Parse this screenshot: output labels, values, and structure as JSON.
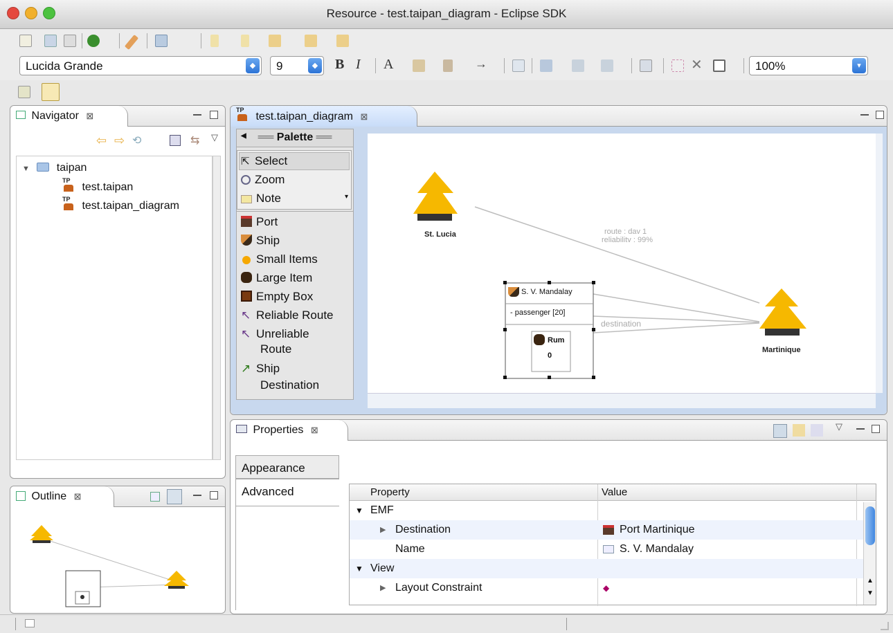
{
  "window": {
    "title": "Resource - test.taipan_diagram - Eclipse SDK",
    "traffic_colors": [
      "#e5483e",
      "#f1b02c",
      "#4cc23f"
    ]
  },
  "toolbar": {
    "font_name": "Lucida Grande",
    "font_size": "9",
    "bold_label": "B",
    "italic_label": "I",
    "font_color_label": "A",
    "zoom": "100%"
  },
  "navigator": {
    "tab_label": "Navigator",
    "close_glyph": "⊠",
    "tree": [
      {
        "label": "taipan",
        "type": "folder",
        "expanded": true
      },
      {
        "label": "test.taipan",
        "type": "file"
      },
      {
        "label": "test.taipan_diagram",
        "type": "file"
      }
    ]
  },
  "editor": {
    "tab_label": "test.taipan_diagram",
    "close_glyph": "⊠"
  },
  "palette": {
    "title": "Palette",
    "items": [
      {
        "label": "Select",
        "icon": "arrow-cursor-icon"
      },
      {
        "label": "Zoom",
        "icon": "zoom-icon"
      },
      {
        "label": "Note",
        "icon": "note-icon"
      },
      {
        "label": "Port",
        "icon": "port-icon"
      },
      {
        "label": "Ship",
        "icon": "ship-icon"
      },
      {
        "label": "Small Items",
        "icon": "small-items-icon"
      },
      {
        "label": "Large Item",
        "icon": "large-item-icon"
      },
      {
        "label": "Empty Box",
        "icon": "empty-box-icon"
      },
      {
        "label": "Reliable Route",
        "icon": "reliable-route-icon"
      },
      {
        "label": "Unreliable",
        "icon": "unreliable-route-icon"
      },
      {
        "label": "Route",
        "icon": ""
      },
      {
        "label": "Ship",
        "icon": "ship-destination-icon"
      },
      {
        "label": "Destination",
        "icon": ""
      }
    ]
  },
  "diagram": {
    "port1_label": "St. Lucia",
    "port2_label": "Martinique",
    "route_label_1": "route : dav 1",
    "route_label_2": "reliabilitv : 99%",
    "destination_label": "destination",
    "ship_name": "S. V. Mandalay",
    "ship_attr": "- passenger [20]",
    "cargo_name": "Rum",
    "cargo_value": "0",
    "port_color": "#f6b800"
  },
  "properties": {
    "tab_label": "Properties",
    "close_glyph": "⊠",
    "side_tabs": [
      "Appearance",
      "Advanced"
    ],
    "columns": [
      "Property",
      "Value"
    ],
    "rows": [
      {
        "property": "EMF",
        "value": "",
        "level": 0,
        "expander": "▼"
      },
      {
        "property": "Destination",
        "value": "Port Martinique",
        "level": 1,
        "expander": "▶"
      },
      {
        "property": "Name",
        "value": "S. V. Mandalay",
        "level": 1,
        "expander": ""
      },
      {
        "property": "View",
        "value": "",
        "level": 0,
        "expander": "▼"
      },
      {
        "property": "Layout Constraint",
        "value": "◆",
        "level": 1,
        "expander": "▶"
      }
    ]
  },
  "outline": {
    "tab_label": "Outline",
    "close_glyph": "⊠"
  }
}
